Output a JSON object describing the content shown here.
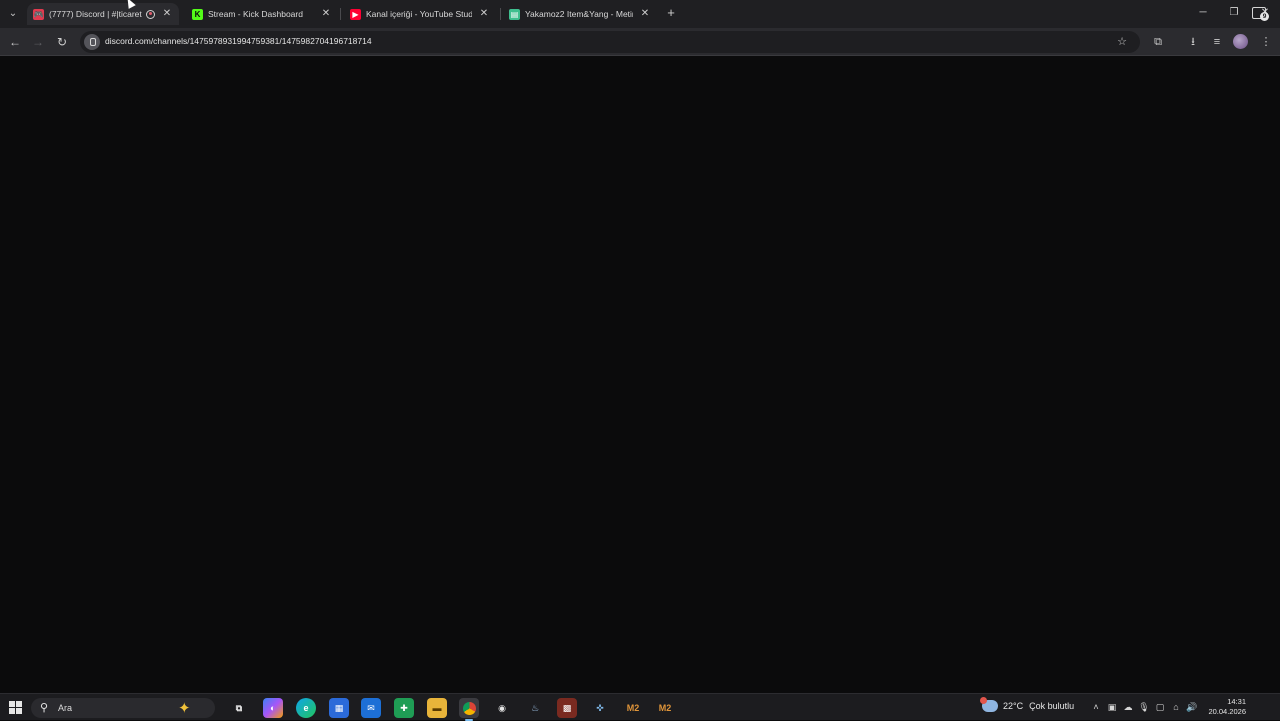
{
  "browser": {
    "tabs": [
      {
        "title": "(7777) Discord | #|ticaret",
        "favicon": "discord-favicon",
        "favicon_color": "#e23a4f",
        "active": true,
        "recording": true
      },
      {
        "title": "Stream - Kick Dashboard",
        "favicon": "kick-favicon",
        "favicon_color": "#53fc18",
        "active": false
      },
      {
        "title": "Kanal içeriği - YouTube Studio",
        "favicon": "youtube-favicon",
        "favicon_color": "#ff0033",
        "active": false
      },
      {
        "title": "Yakamoz2 Item&Yang - Metin2",
        "favicon": "yakamoz-favicon",
        "favicon_color": "#3fbf8f",
        "active": false
      }
    ],
    "address_bar": {
      "url": "discord.com/channels/1475978931994759381/1475982704196718714"
    }
  },
  "taskbar": {
    "search_placeholder": "Ara",
    "apps": [
      {
        "name": "task-view",
        "active": false
      },
      {
        "name": "copilot",
        "active": false
      },
      {
        "name": "edge",
        "active": false
      },
      {
        "name": "microsoft-store",
        "active": false
      },
      {
        "name": "outlook",
        "active": false
      },
      {
        "name": "app-green",
        "active": false
      },
      {
        "name": "file-explorer",
        "active": false
      },
      {
        "name": "chrome",
        "active": true
      },
      {
        "name": "obs",
        "active": false
      },
      {
        "name": "steam",
        "active": false
      },
      {
        "name": "game-launcher",
        "active": false
      },
      {
        "name": "app-blue",
        "active": false
      },
      {
        "name": "metin2-1",
        "label": "M2",
        "active": false
      },
      {
        "name": "metin2-2",
        "label": "M2",
        "active": false
      }
    ],
    "weather": {
      "temp": "22°C",
      "condition": "Çok bulutlu"
    },
    "clock": {
      "time": "14:31",
      "date": "20.04.2026"
    },
    "notification_count": "9"
  }
}
